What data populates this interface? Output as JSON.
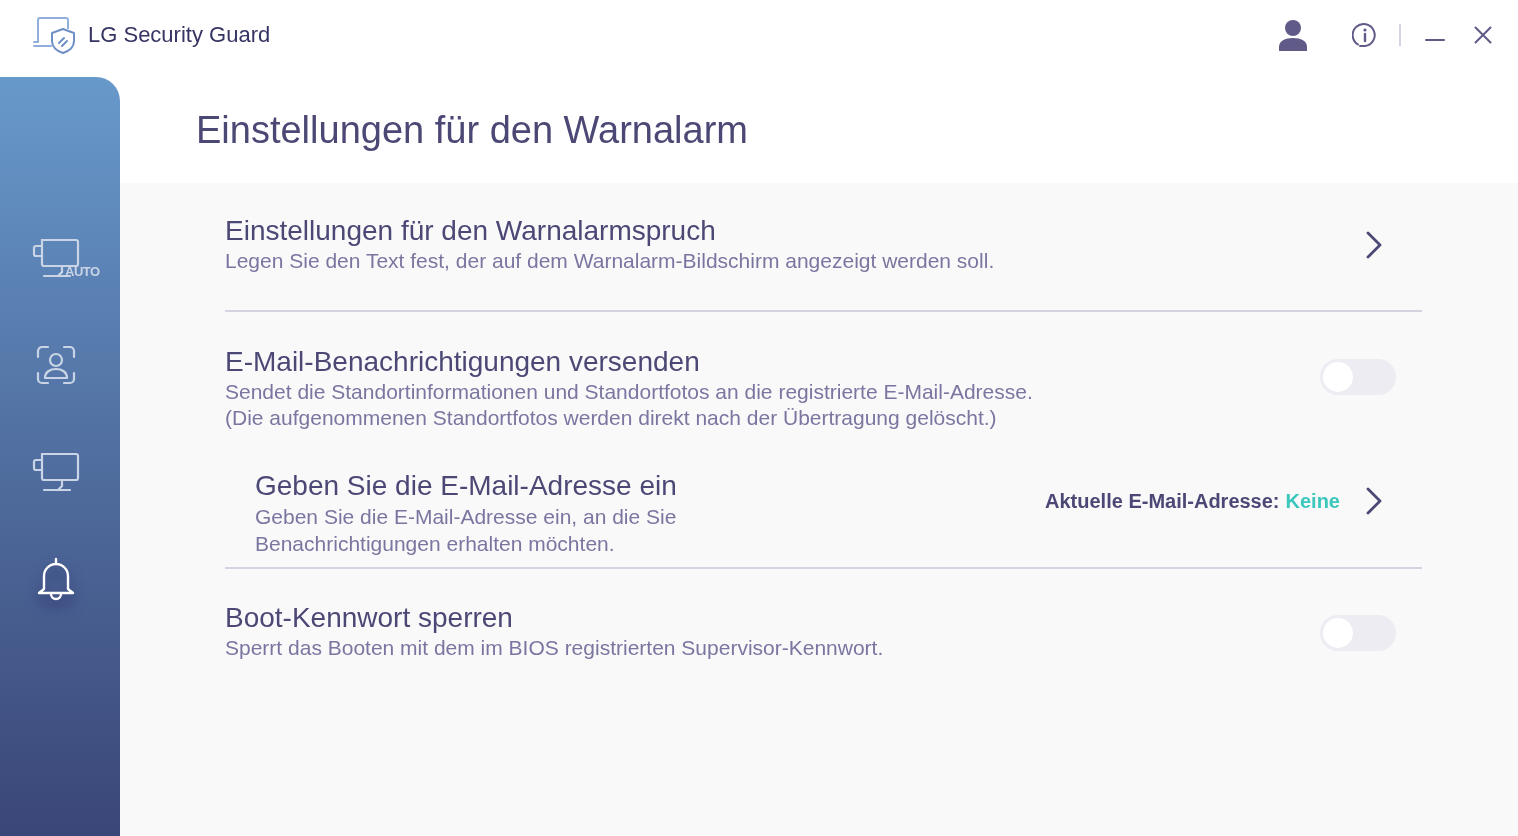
{
  "window": {
    "title": "LG Security Guard"
  },
  "sidebar": {
    "items": [
      {
        "badge": "AUTO",
        "selected": false
      },
      {
        "selected": false
      },
      {
        "selected": false
      },
      {
        "selected": true
      }
    ]
  },
  "page": {
    "title": "Einstellungen für den Warnalarm"
  },
  "sections": [
    {
      "rows": [
        {
          "kind": "link",
          "title": "Einstellungen für den Warnalarmspruch",
          "description": [
            "Legen Sie den Text fest, der auf dem Warnalarm-Bildschirm angezeigt werden soll."
          ]
        }
      ]
    },
    {
      "rows": [
        {
          "kind": "toggle",
          "title": "E-Mail-Benachrichtigungen versenden",
          "description": [
            "Sendet die Standortinformationen und Standortfotos an die registrierte E-Mail-Adresse.",
            "(Die aufgenommenen Standortfotos werden direkt nach der Übertragung gelöscht.)"
          ],
          "on": false
        },
        {
          "kind": "sub_link",
          "title": "Geben Sie die E-Mail-Adresse ein",
          "description": [
            "Geben Sie die E-Mail-Adresse ein, an die Sie Benachrichtigungen erhalten möchten."
          ],
          "current_label": "Aktuelle E-Mail-Adresse:",
          "current_value": "Keine"
        }
      ]
    },
    {
      "rows": [
        {
          "kind": "toggle",
          "title": "Boot-Kennwort sperren",
          "description": [
            "Sperrt das Booten mit dem im BIOS registrierten Supervisor-Kennwort."
          ],
          "on": false
        }
      ]
    }
  ]
}
